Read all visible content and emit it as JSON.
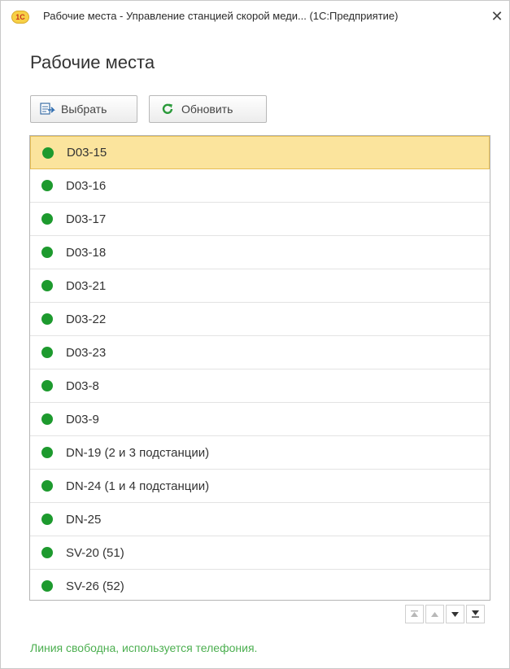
{
  "window": {
    "logo_text": "1С",
    "title": "Рабочие места - Управление станцией скорой меди... (1С:Предприятие)",
    "close_glyph": "✕"
  },
  "page": {
    "title": "Рабочие места"
  },
  "toolbar": {
    "select_label": "Выбрать",
    "refresh_label": "Обновить"
  },
  "list": {
    "items": [
      {
        "label": "D03-15",
        "selected": true
      },
      {
        "label": "D03-16"
      },
      {
        "label": "D03-17"
      },
      {
        "label": "D03-18"
      },
      {
        "label": "D03-21"
      },
      {
        "label": "D03-22"
      },
      {
        "label": "D03-23"
      },
      {
        "label": "D03-8"
      },
      {
        "label": "D03-9"
      },
      {
        "label": "DN-19 (2 и 3 подстанции)"
      },
      {
        "label": "DN-24 (1 и 4 подстанции)"
      },
      {
        "label": "DN-25"
      },
      {
        "label": "SV-20 (51)"
      },
      {
        "label": "SV-26 (52)"
      }
    ],
    "status_dot_color": "#1d9a2e",
    "selected_color": "#fbe49d"
  },
  "status": {
    "text": "Линия свободна, используется телефония."
  }
}
